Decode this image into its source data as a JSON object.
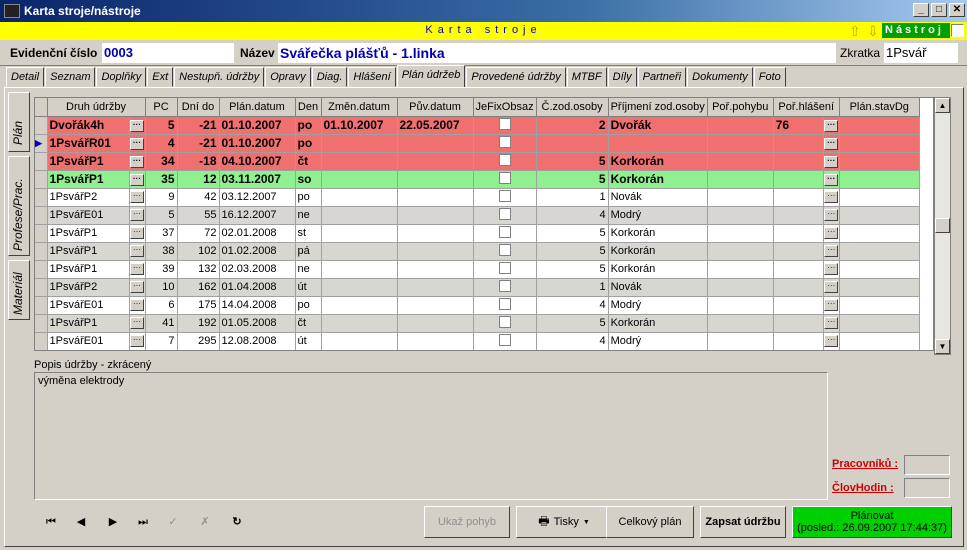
{
  "window": {
    "title": "Karta stroje/nástroje",
    "min": "_",
    "max": "□",
    "close": "✕"
  },
  "header_bar": {
    "title": "Karta stroje",
    "tool_label": "Nástroj"
  },
  "record": {
    "evid_label": "Evidenční číslo",
    "evid_value": "0003",
    "name_label": "Název",
    "name_value": "Svářečka plášťů - 1.linka",
    "short_label": "Zkratka",
    "short_value": "1Psvář"
  },
  "tabs": [
    "Detail",
    "Seznam",
    "Doplňky",
    "Ext",
    "Nestupň. údržby",
    "Opravy",
    "Diag.",
    "Hlášení",
    "Plán údržeb",
    "Provedené údržby",
    "MTBF",
    "Díly",
    "Partneři",
    "Dokumenty",
    "Foto"
  ],
  "vtabs": [
    "Plán",
    "Profese/Prac.",
    "Materiál"
  ],
  "grid": {
    "columns": [
      "Druh údržby",
      "PC",
      "Dní do",
      "Plán.datum",
      "Den",
      "Změn.datum",
      "Pův.datum",
      "JeFixObsaz",
      "Č.zod.osoby",
      "Příjmení zod.osoby",
      "Poř.pohybu",
      "Poř.hlášení",
      "Plán.stavDg"
    ],
    "rows": [
      {
        "druh": "Dvořák4h",
        "pc": "5",
        "dni": "-21",
        "plan": "01.10.2007",
        "den": "po",
        "zmen": "01.10.2007",
        "puv": "22.05.2007",
        "czod": "2",
        "prijmeni": "Dvořák",
        "porhl": "76",
        "style": "red"
      },
      {
        "druh": "1PsvářR01",
        "pc": "4",
        "dni": "-21",
        "plan": "01.10.2007",
        "den": "po",
        "zmen": "",
        "puv": "",
        "czod": "",
        "prijmeni": "",
        "porhl": "",
        "style": "red"
      },
      {
        "druh": "1PsvářP1",
        "pc": "34",
        "dni": "-18",
        "plan": "04.10.2007",
        "den": "čt",
        "zmen": "",
        "puv": "",
        "czod": "5",
        "prijmeni": "Korkorán",
        "porhl": "",
        "style": "red"
      },
      {
        "druh": "1PsvářP1",
        "pc": "35",
        "dni": "12",
        "plan": "03.11.2007",
        "den": "so",
        "zmen": "",
        "puv": "",
        "czod": "5",
        "prijmeni": "Korkorán",
        "porhl": "",
        "style": "green"
      },
      {
        "druh": "1PsvářP2",
        "pc": "9",
        "dni": "42",
        "plan": "03.12.2007",
        "den": "po",
        "zmen": "",
        "puv": "",
        "czod": "1",
        "prijmeni": "Novák",
        "porhl": "",
        "style": "wht"
      },
      {
        "druh": "1PsvářE01",
        "pc": "5",
        "dni": "55",
        "plan": "16.12.2007",
        "den": "ne",
        "zmen": "",
        "puv": "",
        "czod": "4",
        "prijmeni": "Modrý",
        "porhl": "",
        "style": "alt"
      },
      {
        "druh": "1PsvářP1",
        "pc": "37",
        "dni": "72",
        "plan": "02.01.2008",
        "den": "st",
        "zmen": "",
        "puv": "",
        "czod": "5",
        "prijmeni": "Korkorán",
        "porhl": "",
        "style": "wht"
      },
      {
        "druh": "1PsvářP1",
        "pc": "38",
        "dni": "102",
        "plan": "01.02.2008",
        "den": "pá",
        "zmen": "",
        "puv": "",
        "czod": "5",
        "prijmeni": "Korkorán",
        "porhl": "",
        "style": "alt"
      },
      {
        "druh": "1PsvářP1",
        "pc": "39",
        "dni": "132",
        "plan": "02.03.2008",
        "den": "ne",
        "zmen": "",
        "puv": "",
        "czod": "5",
        "prijmeni": "Korkorán",
        "porhl": "",
        "style": "wht"
      },
      {
        "druh": "1PsvářP2",
        "pc": "10",
        "dni": "162",
        "plan": "01.04.2008",
        "den": "út",
        "zmen": "",
        "puv": "",
        "czod": "1",
        "prijmeni": "Novák",
        "porhl": "",
        "style": "alt"
      },
      {
        "druh": "1PsvářE01",
        "pc": "6",
        "dni": "175",
        "plan": "14.04.2008",
        "den": "po",
        "zmen": "",
        "puv": "",
        "czod": "4",
        "prijmeni": "Modrý",
        "porhl": "",
        "style": "wht"
      },
      {
        "druh": "1PsvářP1",
        "pc": "41",
        "dni": "192",
        "plan": "01.05.2008",
        "den": "čt",
        "zmen": "",
        "puv": "",
        "czod": "5",
        "prijmeni": "Korkorán",
        "porhl": "",
        "style": "alt"
      },
      {
        "druh": "1PsvářE01",
        "pc": "7",
        "dni": "295",
        "plan": "12.08.2008",
        "den": "út",
        "zmen": "",
        "puv": "",
        "czod": "4",
        "prijmeni": "Modrý",
        "porhl": "",
        "style": "wht"
      }
    ]
  },
  "desc": {
    "label": "Popis údržby - zkrácený",
    "text": "výměna elektrody"
  },
  "side": {
    "workers_label": "Pracovníků :",
    "hours_label": "ČlovHodin :"
  },
  "nav": {
    "first": "⏮",
    "prev": "◀",
    "next": "▶",
    "last": "⏭",
    "confirm": "✓",
    "cancel": "✗",
    "refresh": "↻"
  },
  "buttons": {
    "show_move": "Ukaž pohyb",
    "print": "Tisky",
    "overall": "Celkový plán",
    "write": "Zapsat údržbu",
    "plan_title": "Plánovat",
    "plan_sub": "(posled.: 26.09.2007 17:44:37)"
  },
  "colors": {
    "overdue": "#f07070",
    "next": "#90f090",
    "plan_button": "#00d000"
  }
}
